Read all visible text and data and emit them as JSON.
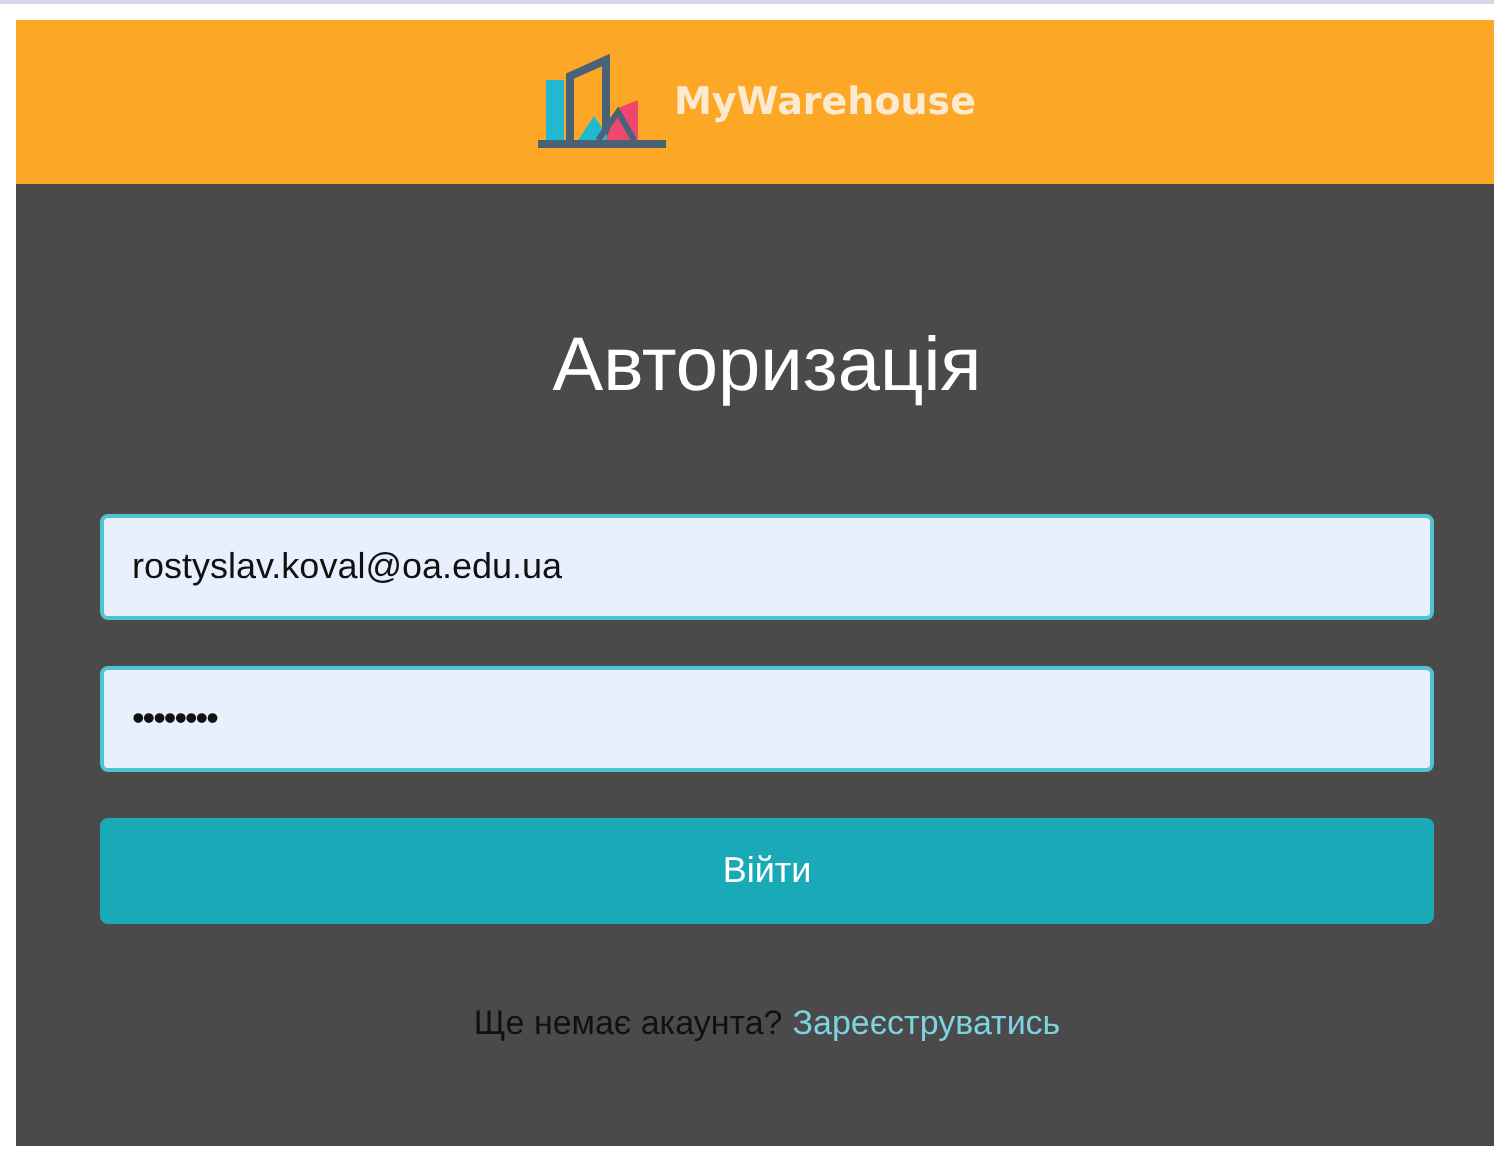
{
  "header": {
    "brand": "MyWarehouse"
  },
  "form": {
    "title": "Авторизація",
    "email": {
      "value": "rostyslav.koval@oa.edu.ua"
    },
    "password": {
      "value": "••••••••"
    },
    "submit": "Війти"
  },
  "footer": {
    "prompt": "Ще немає акаунта?",
    "link": "Зареєструватись"
  }
}
